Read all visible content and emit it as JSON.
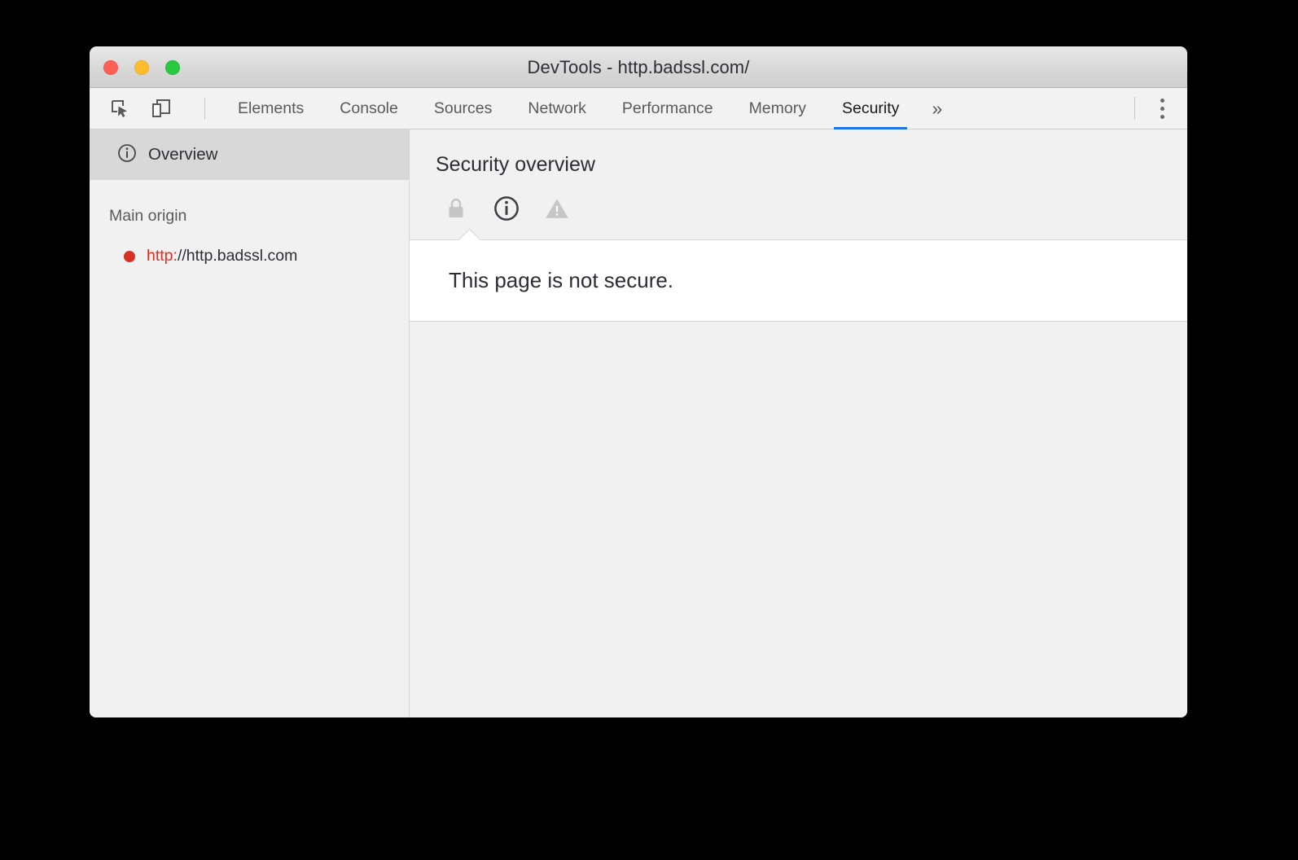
{
  "window": {
    "title": "DevTools - http.badssl.com/",
    "traffic_lights": [
      {
        "name": "close",
        "color": "#ff5f57"
      },
      {
        "name": "minimize",
        "color": "#febc2e"
      },
      {
        "name": "zoom",
        "color": "#28c840"
      }
    ]
  },
  "toolbar": {
    "icons": [
      {
        "name": "inspect-element-icon",
        "title": "Inspect element"
      },
      {
        "name": "device-toolbar-icon",
        "title": "Toggle device toolbar"
      }
    ],
    "menu_icon": "kebab-menu-icon"
  },
  "tabs": [
    {
      "label": "Elements",
      "active": false
    },
    {
      "label": "Console",
      "active": false
    },
    {
      "label": "Sources",
      "active": false
    },
    {
      "label": "Network",
      "active": false
    },
    {
      "label": "Performance",
      "active": false
    },
    {
      "label": "Memory",
      "active": false
    },
    {
      "label": "Security",
      "active": true
    }
  ],
  "tab_overflow_label": "»",
  "accent_color": "#1a73e8",
  "sidebar": {
    "overview": {
      "label": "Overview",
      "icon": "info-circle-icon",
      "selected": true
    },
    "origins_header": "Main origin",
    "origins": [
      {
        "state_color": "#d93025",
        "scheme": "http:",
        "host": "//http.badssl.com"
      }
    ]
  },
  "main": {
    "title": "Security overview",
    "state_icons": [
      {
        "name": "lock-icon",
        "state": "inactive"
      },
      {
        "name": "info-icon",
        "state": "active"
      },
      {
        "name": "warning-icon",
        "state": "inactive"
      }
    ],
    "explanation": "This page is not secure."
  }
}
